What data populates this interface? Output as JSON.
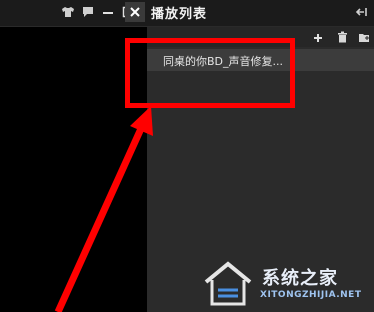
{
  "titlebar": {
    "panel_title": "播放列表",
    "icons": [
      "shirt-icon",
      "chat-icon",
      "minimize-icon",
      "maximize-icon",
      "close-icon",
      "pin-icon"
    ]
  },
  "toolbar": {
    "icons": [
      "add-icon",
      "trash-icon",
      "folder-icon"
    ]
  },
  "playlist": {
    "items": [
      {
        "label": "同桌的你BD_声音修复..."
      }
    ]
  },
  "annotation": {
    "box_color": "#ff0000",
    "arrow_color": "#ff0000"
  },
  "watermark": {
    "title": "系统之家",
    "url": "XITONGZHIJIA.NET"
  }
}
